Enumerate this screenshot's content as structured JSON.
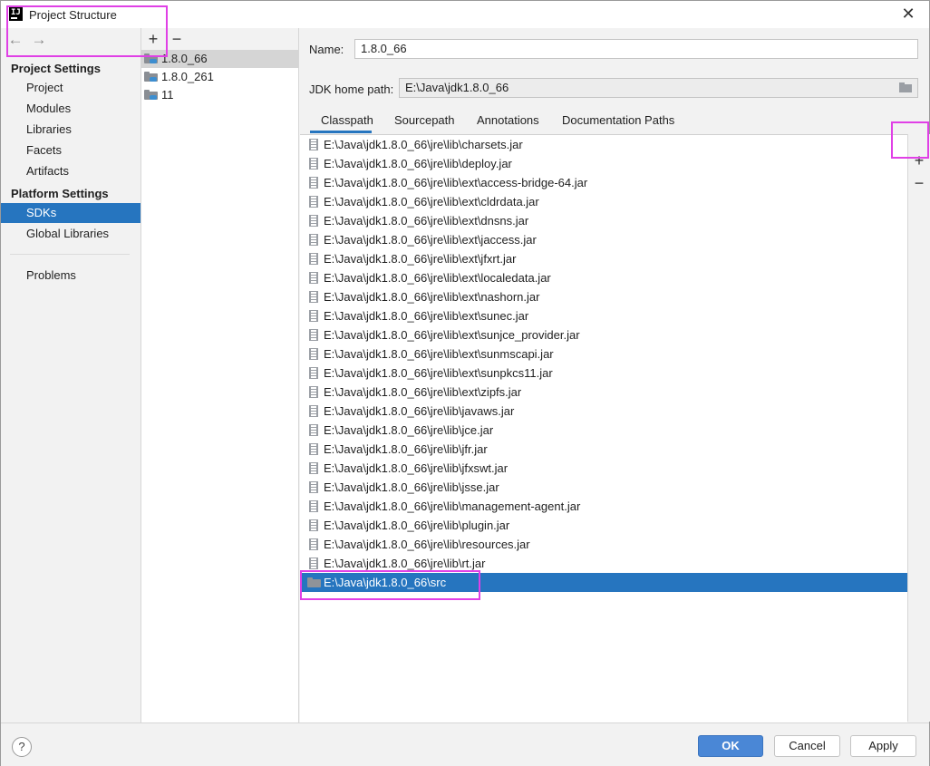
{
  "window": {
    "title": "Project Structure"
  },
  "sidebar": {
    "project_settings_title": "Project Settings",
    "project_items": [
      "Project",
      "Modules",
      "Libraries",
      "Facets",
      "Artifacts"
    ],
    "platform_settings_title": "Platform Settings",
    "platform_items": [
      "SDKs",
      "Global Libraries"
    ],
    "selected": "SDKs",
    "problems": "Problems"
  },
  "sdks": {
    "items": [
      "1.8.0_66",
      "1.8.0_261",
      "11"
    ],
    "selected": "1.8.0_66"
  },
  "details": {
    "name_label": "Name:",
    "name_value": "1.8.0_66",
    "jdk_home_label": "JDK home path:",
    "jdk_home_value": "E:\\Java\\jdk1.8.0_66",
    "tabs": [
      "Classpath",
      "Sourcepath",
      "Annotations",
      "Documentation Paths"
    ],
    "active_tab": "Classpath"
  },
  "classpath": {
    "items": [
      "E:\\Java\\jdk1.8.0_66\\jre\\lib\\charsets.jar",
      "E:\\Java\\jdk1.8.0_66\\jre\\lib\\deploy.jar",
      "E:\\Java\\jdk1.8.0_66\\jre\\lib\\ext\\access-bridge-64.jar",
      "E:\\Java\\jdk1.8.0_66\\jre\\lib\\ext\\cldrdata.jar",
      "E:\\Java\\jdk1.8.0_66\\jre\\lib\\ext\\dnsns.jar",
      "E:\\Java\\jdk1.8.0_66\\jre\\lib\\ext\\jaccess.jar",
      "E:\\Java\\jdk1.8.0_66\\jre\\lib\\ext\\jfxrt.jar",
      "E:\\Java\\jdk1.8.0_66\\jre\\lib\\ext\\localedata.jar",
      "E:\\Java\\jdk1.8.0_66\\jre\\lib\\ext\\nashorn.jar",
      "E:\\Java\\jdk1.8.0_66\\jre\\lib\\ext\\sunec.jar",
      "E:\\Java\\jdk1.8.0_66\\jre\\lib\\ext\\sunjce_provider.jar",
      "E:\\Java\\jdk1.8.0_66\\jre\\lib\\ext\\sunmscapi.jar",
      "E:\\Java\\jdk1.8.0_66\\jre\\lib\\ext\\sunpkcs11.jar",
      "E:\\Java\\jdk1.8.0_66\\jre\\lib\\ext\\zipfs.jar",
      "E:\\Java\\jdk1.8.0_66\\jre\\lib\\javaws.jar",
      "E:\\Java\\jdk1.8.0_66\\jre\\lib\\jce.jar",
      "E:\\Java\\jdk1.8.0_66\\jre\\lib\\jfr.jar",
      "E:\\Java\\jdk1.8.0_66\\jre\\lib\\jfxswt.jar",
      "E:\\Java\\jdk1.8.0_66\\jre\\lib\\jsse.jar",
      "E:\\Java\\jdk1.8.0_66\\jre\\lib\\management-agent.jar",
      "E:\\Java\\jdk1.8.0_66\\jre\\lib\\plugin.jar",
      "E:\\Java\\jdk1.8.0_66\\jre\\lib\\resources.jar",
      "E:\\Java\\jdk1.8.0_66\\jre\\lib\\rt.jar",
      "E:\\Java\\jdk1.8.0_66\\src"
    ],
    "selected": "E:\\Java\\jdk1.8.0_66\\src"
  },
  "footer": {
    "help": "?",
    "ok": "OK",
    "cancel": "Cancel",
    "apply": "Apply"
  },
  "colors": {
    "accent": "#2675bf",
    "highlight": "#e040e6"
  }
}
